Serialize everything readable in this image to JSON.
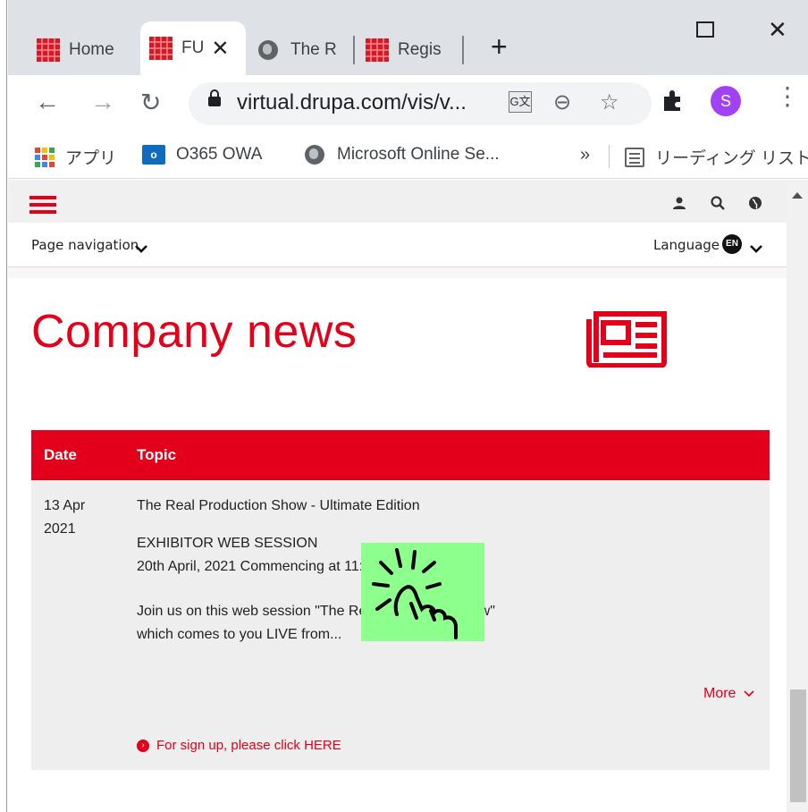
{
  "browser": {
    "tabs": [
      {
        "label": "Home",
        "active": false
      },
      {
        "label": "FU",
        "active": true
      },
      {
        "label": "The R",
        "active": false
      },
      {
        "label": "Regis",
        "active": false
      }
    ],
    "url": "virtual.drupa.com/vis/v...",
    "avatar_initial": "S",
    "bookmarks": {
      "apps": "アプリ",
      "owa": "O365 OWA",
      "owa_badge": "o",
      "microsoft": "Microsoft Online Se...",
      "overflow": "»",
      "reading_list": "リーディング リスト"
    }
  },
  "site": {
    "page_navigation": "Page navigation",
    "language_label": "Language",
    "language_badge": "EN",
    "heading": "Company news",
    "table": {
      "col_date": "Date",
      "col_topic": "Topic",
      "rows": [
        {
          "date_line1": "13 Apr",
          "date_line2": "2021",
          "title": "The Real Production Show - Ultimate Edition",
          "session": "EXHIBITOR WEB SESSION",
          "when": "20th April, 2021 Commencing at 11:20  (CET)",
          "desc1": "Join us on this web session \"The Real Production Show\"",
          "desc2": "which comes to you LIVE from...",
          "more": "More",
          "signup": "For sign up, please click HERE"
        }
      ]
    }
  },
  "colors": {
    "brand_red": "#e2001a",
    "overlay_green": "#8cff8c"
  }
}
